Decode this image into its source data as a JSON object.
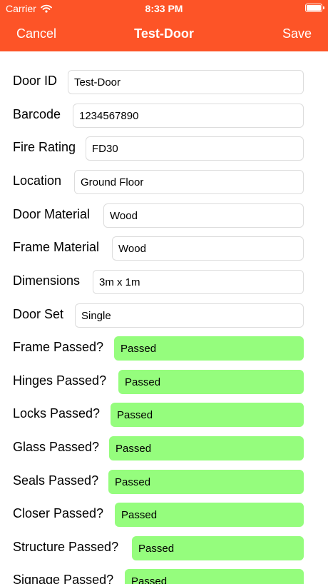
{
  "status_bar": {
    "carrier": "Carrier",
    "time": "8:33 PM"
  },
  "nav": {
    "cancel_label": "Cancel",
    "title": "Test-Door",
    "save_label": "Save"
  },
  "colors": {
    "header": "#fd5427",
    "passed_field": "#95fd7d"
  },
  "fields": [
    {
      "label": "Door ID",
      "value": "Test-Door"
    },
    {
      "label": "Barcode",
      "value": "1234567890"
    },
    {
      "label": "Fire Rating",
      "value": "FD30"
    },
    {
      "label": "Location",
      "value": "Ground Floor"
    },
    {
      "label": "Door Material",
      "value": "Wood"
    },
    {
      "label": "Frame Material",
      "value": "Wood"
    },
    {
      "label": "Dimensions",
      "value": "3m x 1m"
    },
    {
      "label": "Door Set",
      "value": "Single"
    },
    {
      "label": "Frame Passed?",
      "value": "Passed"
    },
    {
      "label": "Hinges Passed?",
      "value": "Passed"
    },
    {
      "label": "Locks Passed?",
      "value": "Passed"
    },
    {
      "label": "Glass Passed?",
      "value": "Passed"
    },
    {
      "label": "Seals Passed?",
      "value": "Passed"
    },
    {
      "label": "Closer Passed?",
      "value": "Passed"
    },
    {
      "label": "Structure Passed?",
      "value": "Passed"
    },
    {
      "label": "Signage Passed?",
      "value": "Passed"
    }
  ]
}
